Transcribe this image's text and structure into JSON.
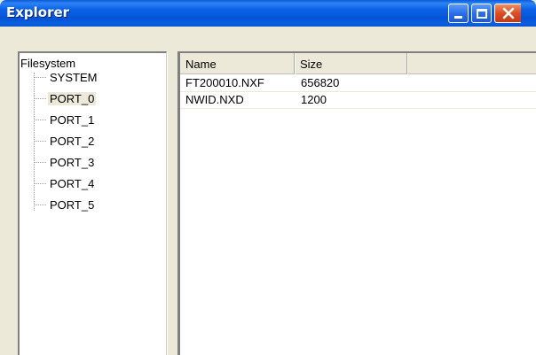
{
  "window": {
    "title": "Explorer",
    "buttons": {
      "minimize": "minimize",
      "maximize": "maximize",
      "close": "close"
    }
  },
  "tree": {
    "root": "Filesystem",
    "items": [
      {
        "label": "SYSTEM",
        "selected": false
      },
      {
        "label": "PORT_0",
        "selected": true
      },
      {
        "label": "PORT_1",
        "selected": false
      },
      {
        "label": "PORT_2",
        "selected": false
      },
      {
        "label": "PORT_3",
        "selected": false
      },
      {
        "label": "PORT_4",
        "selected": false
      },
      {
        "label": "PORT_5",
        "selected": false
      }
    ]
  },
  "list": {
    "columns": [
      "Name",
      "Size",
      ""
    ],
    "rows": [
      {
        "name": "FT200010.NXF",
        "size": "656820"
      },
      {
        "name": "NWID.NXD",
        "size": "1200"
      }
    ]
  },
  "colors": {
    "titlebar": "#0553d6",
    "close_button": "#dd4d22",
    "window_face": "#ece9d8",
    "selection": "#ece9d8"
  }
}
